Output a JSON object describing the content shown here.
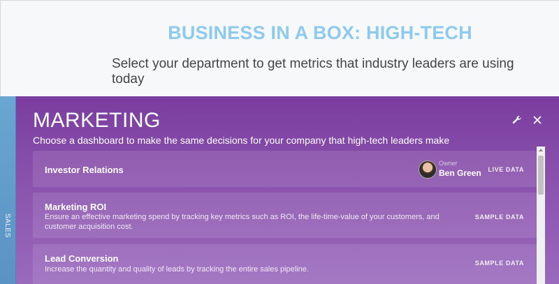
{
  "header": {
    "title": "BUSINESS IN A BOX: HIGH-TECH",
    "subtitle": "Select your department to get metrics that industry leaders are using today"
  },
  "side_tab": {
    "label": "SALES"
  },
  "panel": {
    "title": "MARKETING",
    "subtitle": "Choose a dashboard to make the same decisions for your company that high-tech leaders make",
    "icons": [
      "wrench-icon",
      "close-icon"
    ]
  },
  "dashboards": [
    {
      "title": "Investor Relations",
      "owner_label": "Owner",
      "owner_name": "Ben Green",
      "tag": "LIVE DATA"
    },
    {
      "title": "Marketing ROI",
      "description": "Ensure an effective marketing spend by tracking key metrics such as ROI, the life-time-value of your customers, and customer acquisition cost.",
      "tag": "SAMPLE DATA"
    },
    {
      "title": "Lead Conversion",
      "description": "Increase the quantity and quality of leads by tracking the entire sales pipeline.",
      "tag": "SAMPLE DATA"
    }
  ],
  "colors": {
    "header_title": "#8ec9ee",
    "panel_bg_top": "#7a3d9f",
    "panel_bg_bottom": "#9a6abd",
    "side_tab": "#6aa6d2"
  }
}
